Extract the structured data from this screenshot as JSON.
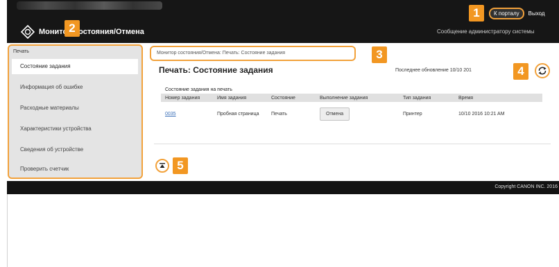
{
  "header": {
    "app_title": "Монитор состояния/Отмена",
    "portal_link": "К порталу",
    "logout_link": "Выход",
    "admin_message": "Сообщение администратору системы"
  },
  "sidebar": {
    "group_label": "Печать",
    "items": [
      {
        "label": "Состояние задания",
        "active": true
      },
      {
        "label": "Информация об ошибке",
        "active": false
      },
      {
        "label": "Расходные материалы",
        "active": false
      },
      {
        "label": "Характеристики устройства",
        "active": false
      },
      {
        "label": "Сведения об устройстве",
        "active": false
      },
      {
        "label": "Проверить счетчик",
        "active": false
      }
    ]
  },
  "main": {
    "breadcrumb": "Монитор состояния/Отмена: Печать: Состояние задания",
    "title": "Печать: Состояние задания",
    "last_update": "Последнее обновление 10/10 201",
    "section_title": "Состояние задания на печать",
    "columns": [
      "Номер задания",
      "Имя задания",
      "Состояние",
      "Выполнение задания",
      "Тип задания",
      "Время"
    ],
    "rows": [
      {
        "job_number": "0035",
        "job_name": "Пробная страница",
        "status": "Печать",
        "action": "Отмена",
        "job_type": "Принтер",
        "time": "10/10 2016 10:21 AM"
      }
    ]
  },
  "footer": {
    "copyright": "Copyright CANON INC. 2016"
  },
  "callouts": [
    "1",
    "2",
    "3",
    "4",
    "5"
  ],
  "colors": {
    "accent_orange": "#f29722",
    "highlight_border": "#f2a13a",
    "header_bg": "#161616",
    "link_blue": "#3a6fb8"
  },
  "icons": [
    "canon-logo-icon",
    "refresh-icon",
    "scroll-to-top-icon"
  ]
}
